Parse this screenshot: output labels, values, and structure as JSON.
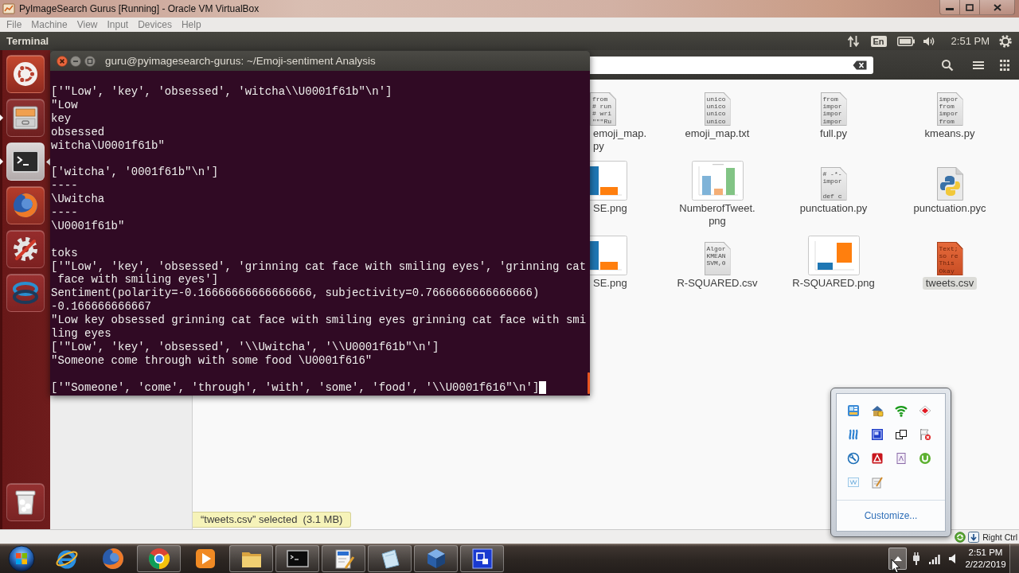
{
  "host_window": {
    "title": "PyImageSearch Gurus [Running] - Oracle VM VirtualBox",
    "menu": [
      "File",
      "Machine",
      "View",
      "Input",
      "Devices",
      "Help"
    ]
  },
  "top_panel": {
    "app_name": "Terminal",
    "keyboard_layout": "En",
    "time": "2:51 PM"
  },
  "launcher": {
    "items": [
      {
        "kind": "dash",
        "running": false,
        "focused": false
      },
      {
        "kind": "files",
        "running": true,
        "focused": false
      },
      {
        "kind": "terminal",
        "running": true,
        "focused": true
      },
      {
        "kind": "globe",
        "running": false,
        "focused": false
      },
      {
        "kind": "settings",
        "running": false,
        "focused": false
      },
      {
        "kind": "swirl",
        "running": false,
        "focused": false
      },
      {
        "kind": "trash",
        "running": false,
        "focused": false
      }
    ]
  },
  "file_manager": {
    "files": [
      {
        "label": [
          "emoji_map.",
          "py"
        ],
        "kind": "text",
        "preview": "from\n# run\n# wri\n\"\"\"Ru",
        "selected": false
      },
      {
        "label": [
          "emoji_map.txt"
        ],
        "kind": "text",
        "preview": "unico\nunico\nunico\nunico",
        "selected": false
      },
      {
        "label": [
          "full.py"
        ],
        "kind": "text",
        "preview": "from\nimpor\nimpor\nimpor",
        "selected": false
      },
      {
        "label": [
          "kmeans.py"
        ],
        "kind": "text",
        "preview": "impor\nfrom\nimpor\nfrom",
        "selected": false
      },
      {
        "label": [
          "SE.png"
        ],
        "kind": "fallingchart",
        "selected": false
      },
      {
        "label": [
          "NumberofTweet.",
          "png"
        ],
        "kind": "threebarchart",
        "selected": false
      },
      {
        "label": [
          "punctuation.py"
        ],
        "kind": "text",
        "preview": "# -*-\nimpor\n\ndef c",
        "selected": false
      },
      {
        "label": [
          "punctuation.pyc"
        ],
        "kind": "bytecode",
        "selected": false
      },
      {
        "label": [
          "SE.png"
        ],
        "kind": "fallingchart",
        "selected": false
      },
      {
        "label": [
          "R-SQUARED.csv"
        ],
        "kind": "text",
        "preview": "Algor\nKMEAN\nSVM,0",
        "selected": false
      },
      {
        "label": [
          "R-SQUARED.png"
        ],
        "kind": "risingchart",
        "selected": false
      },
      {
        "label": [
          "tweets.csv"
        ],
        "kind": "spreadsheet",
        "preview": "Text;\nso re\nThis\nOkay",
        "selected": true
      }
    ],
    "status": "“tweets.csv” selected  (3.1 MB)"
  },
  "terminal": {
    "title": "guru@pyimagesearch-gurus: ~/Emoji-sentiment Analysis",
    "output": [
      [
        "['\"Low', 'key', 'obsessed', 'witcha\\\\U0001f61b\"\\n']",
        "\"Low",
        "key",
        "obsessed",
        "witcha\\U0001f61b\""
      ],
      [
        "['witcha', '0001f61b\"\\n']",
        "----",
        "\\Uwitcha",
        "----",
        "\\U0001f61b\""
      ],
      [
        "toks",
        "['\"Low', 'key', 'obsessed', 'grinning cat face with smiling eyes', 'grinning cat",
        " face with smiling eyes']",
        "Sentiment(polarity=-0.16666666666666666, subjectivity=0.7666666666666666)",
        "-0.166666666667",
        "\"Low key obsessed grinning cat face with smiling eyes grinning cat face with smi",
        "ling eyes",
        "['\"Low', 'key', 'obsessed', '\\\\Uwitcha', '\\\\U0001f61b\"\\n']",
        "\"Someone come through with some food \\U0001f616\""
      ],
      [
        "['\"Someone', 'come', 'through', 'with', 'some', 'food', '\\\\U0001f616\"\\n']"
      ]
    ],
    "cursor": true
  },
  "status_bar": {
    "host_key": "Right Ctrl"
  },
  "taskbar": {
    "items": [
      {
        "kind": "ring",
        "running": false
      },
      {
        "kind": "globe",
        "running": false
      },
      {
        "kind": "wheel",
        "running": true
      },
      {
        "kind": "player",
        "running": false
      },
      {
        "kind": "folder",
        "running": true
      },
      {
        "kind": "console",
        "running": true
      },
      {
        "kind": "editor",
        "running": true
      },
      {
        "kind": "sheet",
        "running": true
      },
      {
        "kind": "cube",
        "running": true
      },
      {
        "kind": "frame",
        "running": true
      }
    ],
    "tray_overflow": {
      "expanded": true,
      "link": "Customize..."
    },
    "clock": {
      "time": "2:51 PM",
      "date": "2/22/2019"
    }
  }
}
